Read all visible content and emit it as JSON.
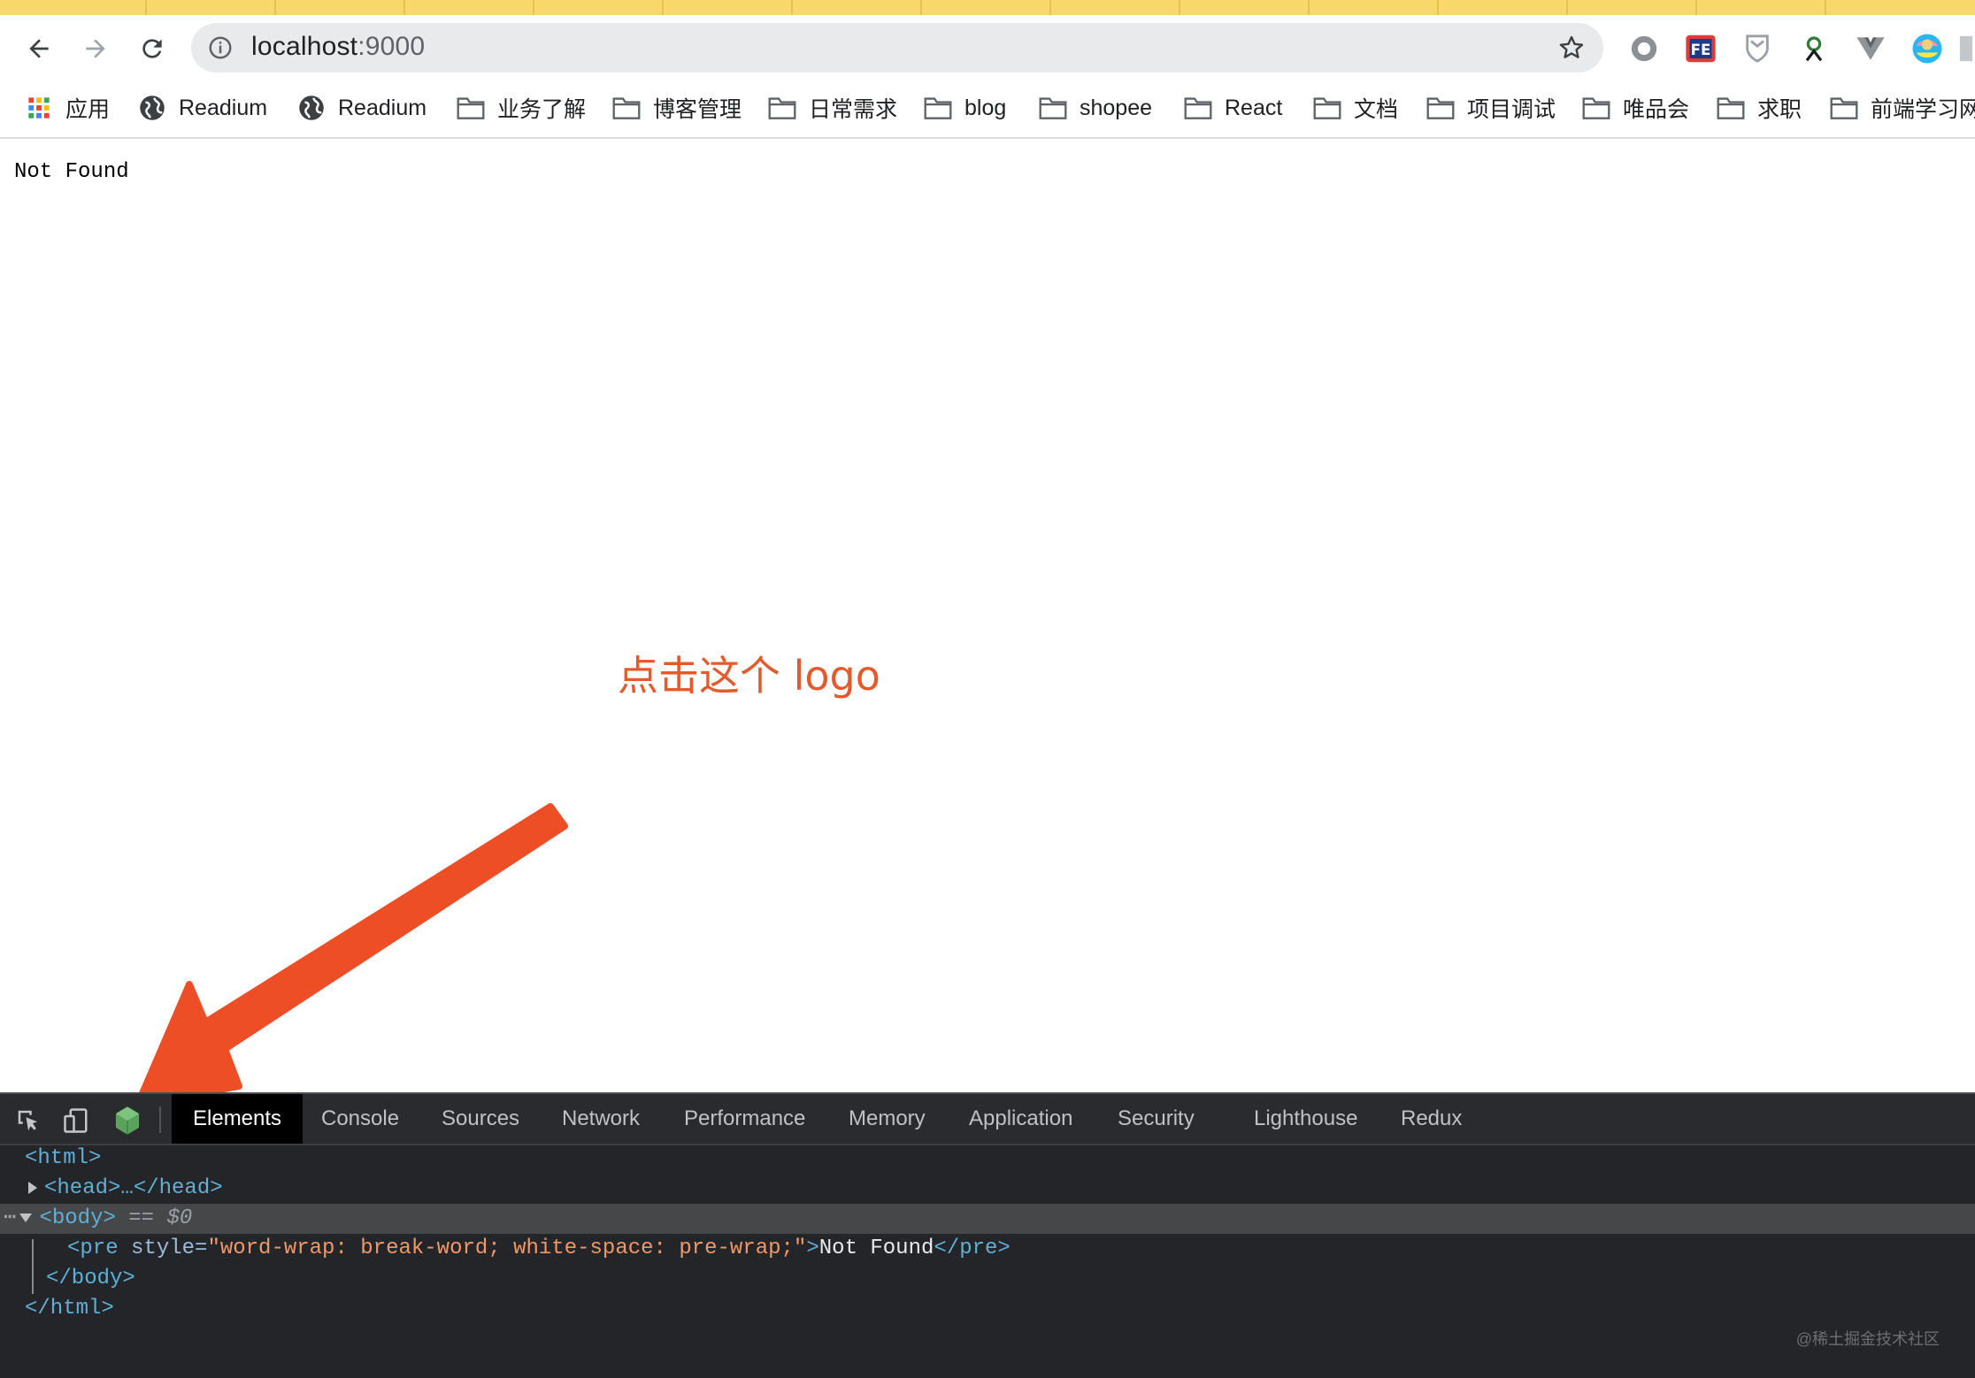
{
  "browser": {
    "url_host": "localhost",
    "url_port": ":9000",
    "extensions": [
      "record-icon",
      "fe-icon",
      "shield-icon",
      "green-extension-icon",
      "vue-devtools-icon",
      "avatar-extension-icon",
      "overflow-extension-icon"
    ]
  },
  "bookmarks": [
    {
      "label": "应用",
      "icon": "apps-grid-icon"
    },
    {
      "label": "Readium",
      "icon": "globe-icon"
    },
    {
      "label": "Readium",
      "icon": "globe-icon"
    },
    {
      "label": "业务了解",
      "icon": "folder-icon"
    },
    {
      "label": "博客管理",
      "icon": "folder-icon"
    },
    {
      "label": "日常需求",
      "icon": "folder-icon"
    },
    {
      "label": "blog",
      "icon": "folder-icon"
    },
    {
      "label": "shopee",
      "icon": "folder-icon"
    },
    {
      "label": "React",
      "icon": "folder-icon"
    },
    {
      "label": "文档",
      "icon": "folder-icon"
    },
    {
      "label": "项目调试",
      "icon": "folder-icon"
    },
    {
      "label": "唯品会",
      "icon": "folder-icon"
    },
    {
      "label": "求职",
      "icon": "folder-icon"
    },
    {
      "label": "前端学习网",
      "icon": "folder-icon"
    }
  ],
  "page": {
    "body_text": "Not Found"
  },
  "annotation": {
    "text": "点击这个 logo",
    "color": "#e5542b"
  },
  "devtools": {
    "tabs": [
      "Elements",
      "Console",
      "Sources",
      "Network",
      "Performance",
      "Memory",
      "Application",
      "Security",
      "Lighthouse",
      "Redux"
    ],
    "active_tab": "Elements",
    "dom": {
      "html_open": "<html>",
      "head": "<head>…</head>",
      "body_open": "<body>",
      "body_marker": "== $0",
      "pre_open": "<pre",
      "pre_attr_name": " style=",
      "pre_attr_value": "\"word-wrap: break-word; white-space: pre-wrap;\"",
      "pre_close_bracket": ">",
      "pre_text": "Not Found",
      "pre_close": "</pre>",
      "body_close": "</body>",
      "html_close": "</html>"
    }
  },
  "watermark": "@稀土掘金技术社区"
}
